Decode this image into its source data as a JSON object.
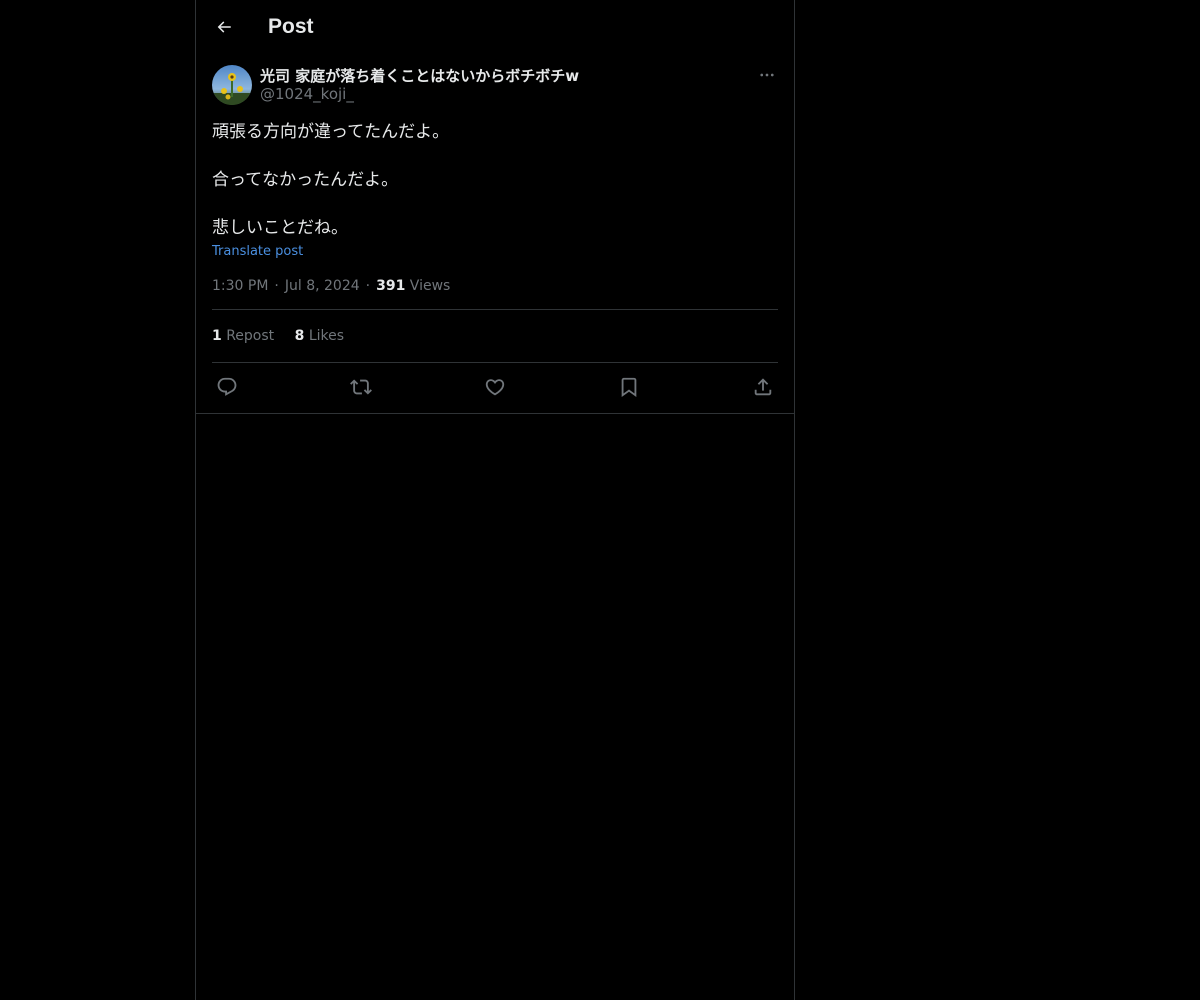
{
  "header": {
    "title": "Post"
  },
  "post": {
    "author": {
      "display_name": "光司 家庭が落ち着くことはないからボチボチw",
      "handle": "@1024_koji_"
    },
    "text_lines": [
      "頑張る方向が違ってたんだよ。",
      "",
      "合ってなかったんだよ。",
      "",
      "悲しいことだね。"
    ],
    "translate_label": "Translate post",
    "time": "1:30 PM",
    "date": "Jul 8, 2024",
    "views_count": "391",
    "views_label": "Views",
    "separator": "·",
    "reposts_count": "1",
    "reposts_label": "Repost",
    "likes_count": "8",
    "likes_label": "Likes"
  },
  "icons": {
    "back": "arrow-left-icon",
    "more": "more-horizontal-icon",
    "reply": "reply-icon",
    "repost": "repost-icon",
    "like": "heart-icon",
    "bookmark": "bookmark-icon",
    "share": "share-icon"
  },
  "colors": {
    "background": "#000000",
    "text_primary": "#e7e9ea",
    "text_secondary": "#71767b",
    "link": "#4a8fe0",
    "border": "#2f3336"
  }
}
